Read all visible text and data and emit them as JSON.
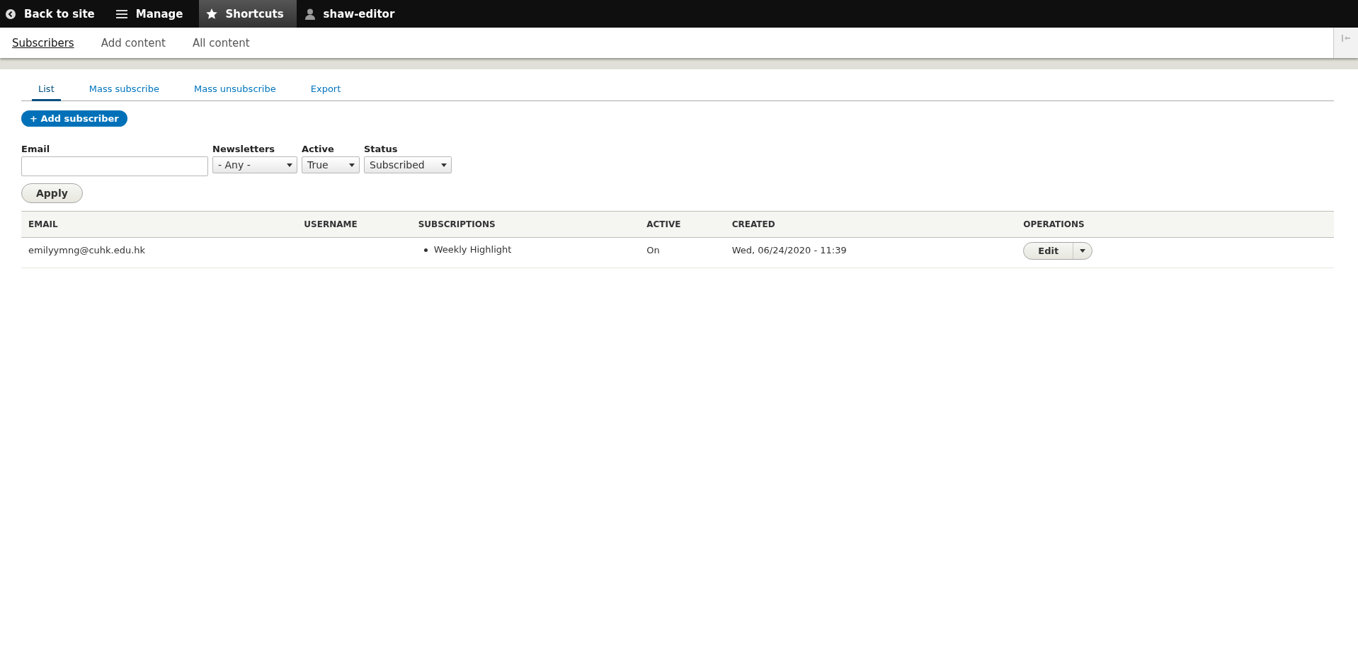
{
  "toolbar": {
    "items": [
      {
        "kind": "back",
        "label": "Back to site",
        "selected": false
      },
      {
        "kind": "menu",
        "label": "Manage",
        "selected": false
      },
      {
        "kind": "star",
        "label": "Shortcuts",
        "selected": true
      },
      {
        "kind": "user",
        "label": "shaw-editor",
        "selected": false
      }
    ]
  },
  "shortcuts": [
    {
      "label": "Subscribers",
      "selected": true
    },
    {
      "label": "Add content",
      "selected": false
    },
    {
      "label": "All content",
      "selected": false
    }
  ],
  "tabs": [
    {
      "label": "List",
      "selected": true
    },
    {
      "label": "Mass subscribe",
      "selected": false
    },
    {
      "label": "Mass unsubscribe",
      "selected": false
    },
    {
      "label": "Export",
      "selected": false
    }
  ],
  "add_button": "+ Add subscriber",
  "filters": [
    {
      "kind": "text",
      "label": "Email"
    },
    {
      "kind": "select",
      "label": "Newsletters",
      "value": "- Any -"
    },
    {
      "kind": "select",
      "label": "Active",
      "value": "True"
    },
    {
      "kind": "select",
      "label": "Status",
      "value": "Subscribed"
    }
  ],
  "apply_button": "Apply",
  "table": {
    "columns": [
      "EMAIL",
      "USERNAME",
      "SUBSCRIPTIONS",
      "ACTIVE",
      "CREATED",
      "OPERATIONS"
    ],
    "rows": [
      {
        "email": "emilyymng@cuhk.edu.hk",
        "subscriptions": [
          "Weekly Highlight"
        ],
        "active": "On",
        "created": "Wed, 06/24/2020 - 11:39",
        "operation": "Edit"
      }
    ]
  }
}
